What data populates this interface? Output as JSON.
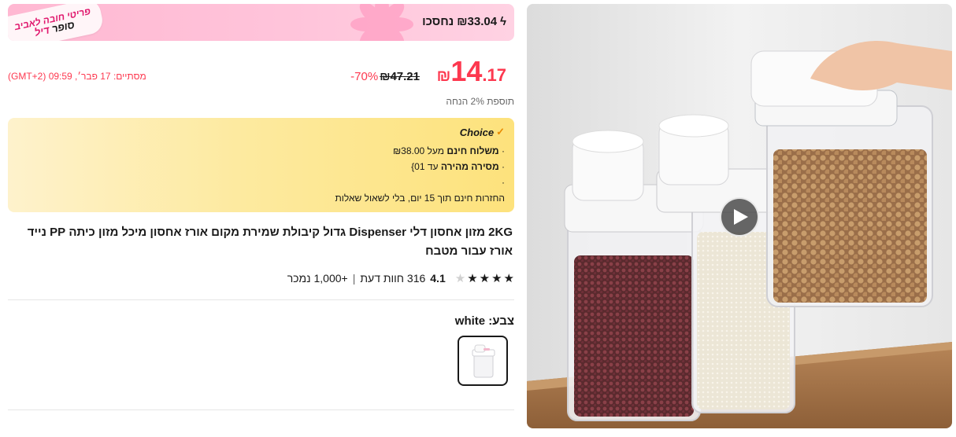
{
  "deal": {
    "save_amount": "₪33.04",
    "save_label": "נחסכו",
    "tag_line1": "פריטי חובה לאביב",
    "tag_line2_a": "סופר",
    "tag_line2_b": "דיל"
  },
  "price": {
    "whole": "14",
    "fraction": ".17",
    "currency": "₪",
    "original": "₪47.21",
    "discount": "-70%",
    "ends": "מסתיים: 17 פבר׳, 09:59 (GMT+2)",
    "bonus": "תוספת 2% הנחה"
  },
  "choice": {
    "title": "Choice",
    "line1_prefix": "משלוח חינם",
    "line1_suffix": "מעל ₪38.00",
    "line2_prefix": "מסירה מהירה",
    "line2_suffix": "עד 01}",
    "line3": "·",
    "line4": "החזרות חינם תוך 15 יום, בלי לשאול שאלות"
  },
  "product": {
    "title": "2KG מזון אחסון דלי Dispenser גדול קיבולת שמירת מקום אורז אחסון מיכל מזון כיתה PP נייד אורז עבור מטבח",
    "rating": "4.1",
    "reviews": "316 חוות דעת",
    "sold": "+1,000 נמכר",
    "rating_fraction": 0.82
  },
  "variant": {
    "label": "צבע:",
    "value": "white"
  },
  "colors": {
    "accent": "#fd384f",
    "choice_gold": "#fde27c",
    "deal_pink": "#ffc5db"
  },
  "icons": {
    "bolt": "lightning-icon",
    "check": "check-icon",
    "play": "play-icon",
    "star": "star-icon"
  }
}
